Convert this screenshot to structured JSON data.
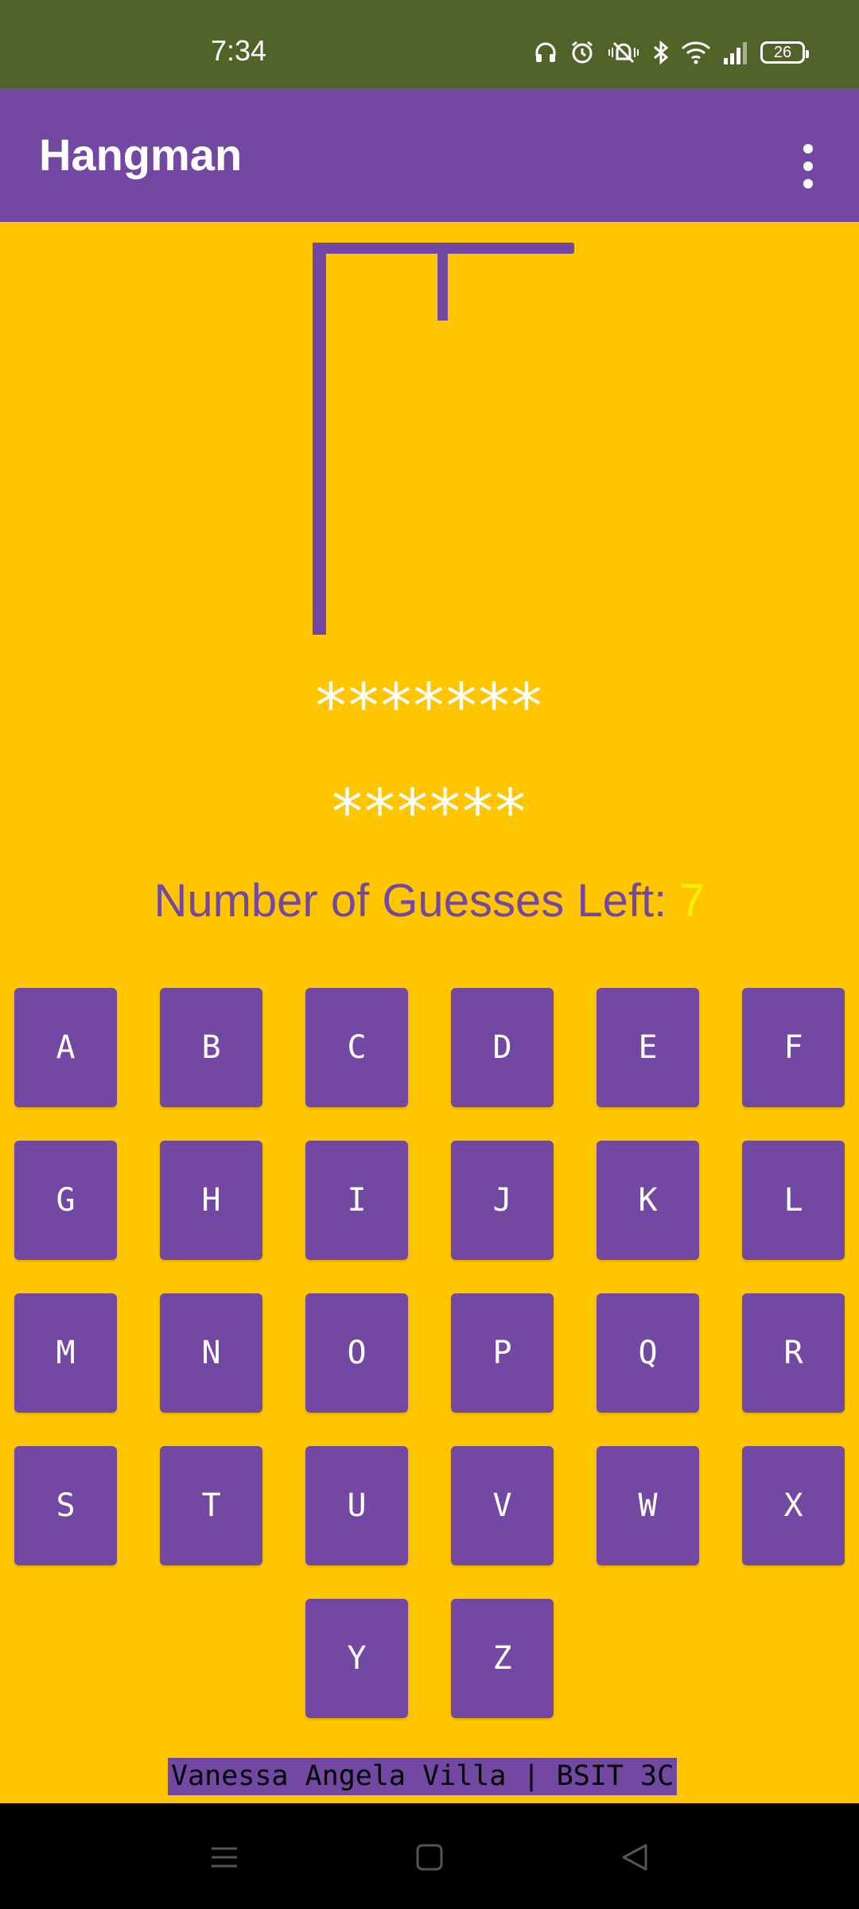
{
  "status_bar": {
    "time": "7:34",
    "battery": "26",
    "icons": [
      "headphones-icon",
      "alarm-icon",
      "mute-vibrate-icon",
      "bluetooth-icon",
      "wifi-icon",
      "signal-icon",
      "battery-icon"
    ]
  },
  "app_bar": {
    "title": "Hangman",
    "menu_icon": "more-vert-icon"
  },
  "game": {
    "word_display_1": "*******",
    "word_display_2": "******",
    "guesses_label": "Number of Guesses Left: ",
    "guesses_left": "7"
  },
  "keyboard": {
    "keys": [
      "A",
      "B",
      "C",
      "D",
      "E",
      "F",
      "G",
      "H",
      "I",
      "J",
      "K",
      "L",
      "M",
      "N",
      "O",
      "P",
      "Q",
      "R",
      "S",
      "T",
      "U",
      "V",
      "W",
      "X",
      "Y",
      "Z"
    ]
  },
  "footer": {
    "credit": "Vanessa Angela Villa | BSIT 3C"
  },
  "nav_bar": {
    "icons": [
      "menu-icon",
      "home-icon",
      "back-icon"
    ]
  },
  "colors": {
    "background": "#FFC600",
    "primary": "#7248A3",
    "status_bar": "#506328",
    "accent_count": "#F5F000"
  }
}
